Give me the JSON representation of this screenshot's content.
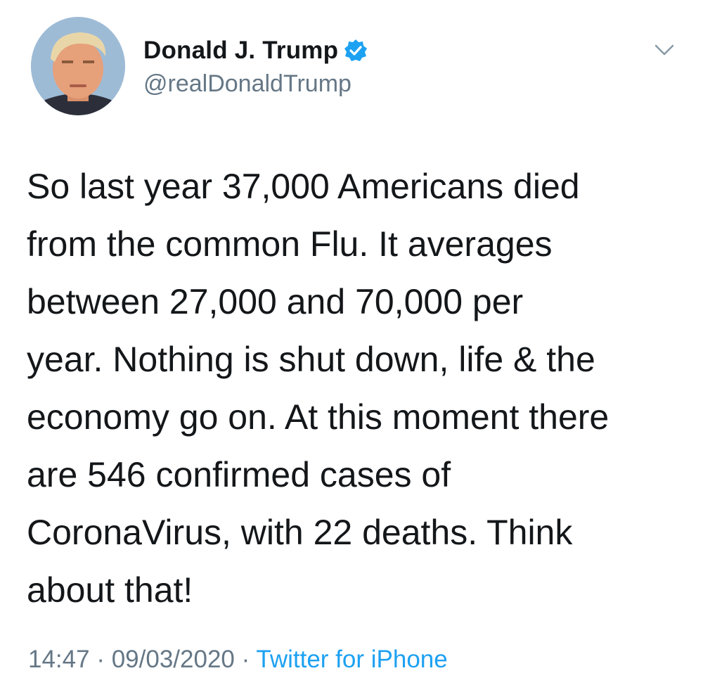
{
  "tweet": {
    "display_name": "Donald J. Trump",
    "verified_icon": "verified-badge-icon",
    "handle": "@realDonaldTrump",
    "text": "So last year 37,000 Americans died\nfrom the common Flu. It averages\nbetween 27,000 and 70,000 per\nyear. Nothing is shut down, life & the\neconomy go on. At this moment there\nare 546 confirmed cases of\nCoronaVirus, with 22 deaths. Think\nabout that!",
    "time": "14:47",
    "separator": "·",
    "date": "09/03/2020",
    "source": "Twitter for iPhone",
    "menu_icon": "chevron-down-icon"
  },
  "colors": {
    "text": "#14171a",
    "secondary": "#657786",
    "accent": "#1da1f2"
  }
}
